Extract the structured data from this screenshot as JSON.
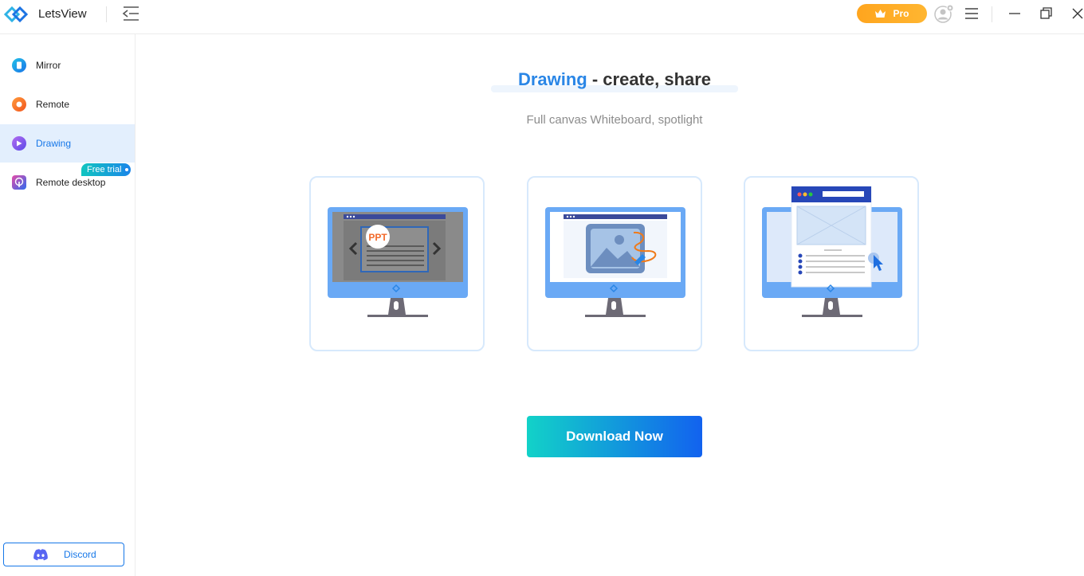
{
  "app": {
    "title": "LetsView"
  },
  "titlebar": {
    "pro_label": "Pro"
  },
  "sidebar": {
    "items": [
      {
        "label": "Mirror",
        "icon": "mirror-icon"
      },
      {
        "label": "Remote",
        "icon": "remote-icon"
      },
      {
        "label": "Drawing",
        "icon": "drawing-icon",
        "active": true
      },
      {
        "label": "Remote desktop",
        "icon": "remote-desktop-icon"
      }
    ],
    "badge": "Free trial",
    "discord_label": "Discord"
  },
  "main": {
    "headline_accent": "Drawing",
    "headline_rest": " - create, share",
    "subtitle": "Full canvas Whiteboard, spotlight",
    "cards": [
      {
        "icon": "ppt-slides-illustration",
        "ppt_text": "PPT"
      },
      {
        "icon": "image-annotation-illustration"
      },
      {
        "icon": "spotlight-browser-illustration"
      }
    ],
    "download_label": "Download Now"
  },
  "colors": {
    "accent": "#2a86e6",
    "pro_orange": "#ffa51e",
    "active_bg": "#e3effd",
    "button_start": "#12d2c8",
    "button_end": "#1262ef"
  }
}
